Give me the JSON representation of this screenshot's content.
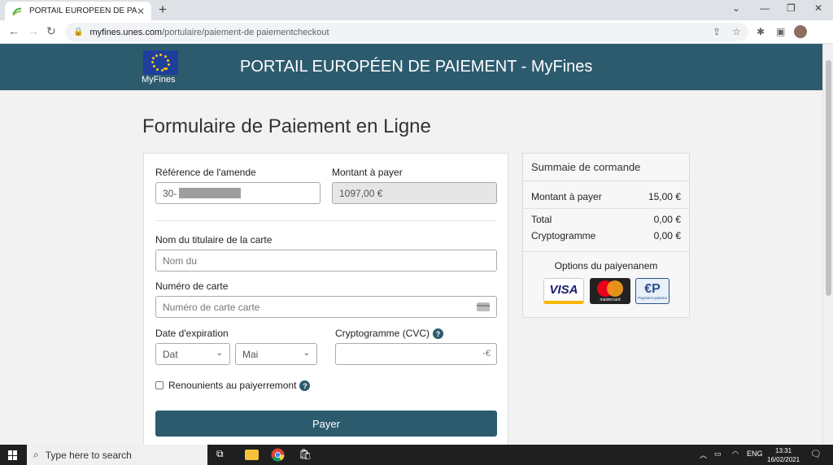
{
  "browser": {
    "tab_title": "PORTAIL EUROPÉEN DE PAIEME",
    "url_host": "myfines.unes.com",
    "url_path": "/portulaire/paiement-de paiementcheckout"
  },
  "header": {
    "brand": "MyFines",
    "title": "PORTAIL EUROPÉEN DE PAIEMENT - MyFines"
  },
  "page": {
    "title": "Formulaire de Paiement en Ligne"
  },
  "form": {
    "reference_label": "Référence de l'amende",
    "reference_value": "30-",
    "amount_label": "Montant à payer",
    "amount_value": "1097,00 €",
    "holder_label": "Nom du titulaire de la carte",
    "holder_placeholder": "Nom du",
    "card_label": "Numéro de carte",
    "card_placeholder": "Numéro de carte carte",
    "expiry_label": "Date d'expiration",
    "expiry_day": "Dat",
    "expiry_month": "Mai",
    "cvc_label": "Cryptogramme (CVC)",
    "remember_label": "Renounients au paiyerremont",
    "pay_button": "Payer"
  },
  "summary": {
    "title": "Summaie de cormande",
    "amount_label": "Montant à payer",
    "amount_value": "15,00 €",
    "total_label": "Total",
    "total_value": "0,00 €",
    "crypto_label": "Cryptogramme",
    "crypto_value": "0,00 €",
    "options_title": "Options du paiyenanem",
    "logos": {
      "visa": "VISA",
      "mastercard": "mastercard",
      "ep_mark": "€P",
      "ep_text": "Payment systems"
    }
  },
  "taskbar": {
    "search_placeholder": "Type here to search",
    "lang": "ENG",
    "time": "13:31",
    "date": "16/02/2021"
  },
  "colors": {
    "header": "#2d5b6e",
    "pay_button": "#2d5b6e",
    "eu_blue": "#1f3f9b",
    "eu_gold": "#ffcc00"
  }
}
